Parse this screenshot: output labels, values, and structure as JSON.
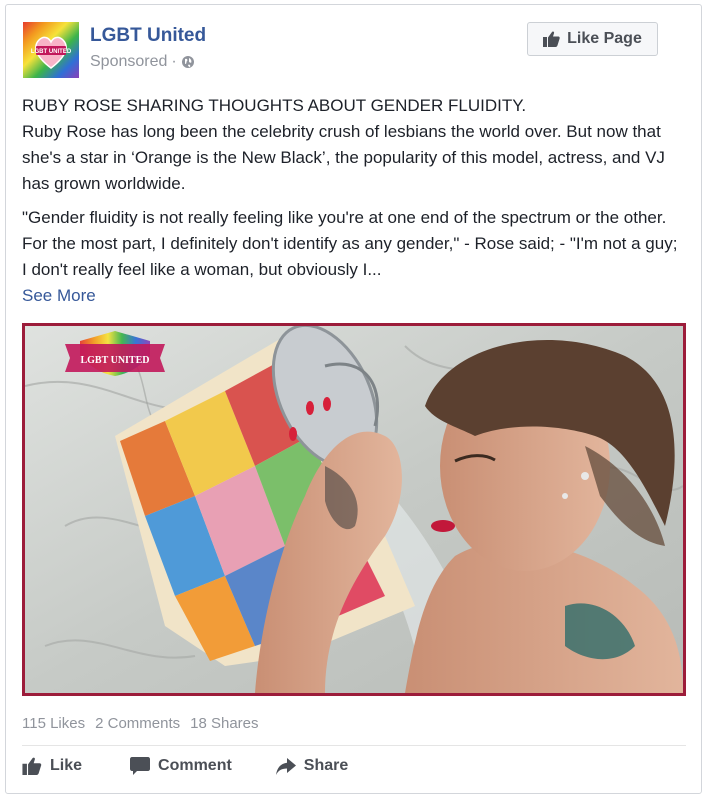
{
  "post": {
    "page_name": "LGBT United",
    "sponsored_label": "Sponsored",
    "separator": "·",
    "like_page_label": "Like Page",
    "headline": "RUBY ROSE SHARING THOUGHTS ABOUT GENDER FLUIDITY.",
    "body": "Ruby Rose has long been the celebrity crush of lesbians the world over. But now that she's a star in ‘Orange is the New Black’, the popularity of this model, actress, and VJ has grown worldwide.",
    "quote": "\"Gender fluidity is not really feeling like you're at one end of the spectrum or the other. For the most part, I definitely don't identify as any gender,\" - Rose said; - \"I'm not a guy; I don't really feel like a woman, but obviously I...",
    "see_more_label": "See More",
    "image_logo_text": "LGBT UNITED",
    "avatar_logo_text": "LGBT UNITED"
  },
  "stats": {
    "likes": "115 Likes",
    "comments": "2 Comments",
    "shares": "18 Shares"
  },
  "actions": {
    "like_label": "Like",
    "comment_label": "Comment",
    "share_label": "Share"
  },
  "colors": {
    "link_blue": "#365899",
    "meta_gray": "#90949c",
    "image_border": "#9c1c3a"
  },
  "icons": {
    "globe": "globe-icon",
    "thumbs_up": "thumbs-up-icon",
    "comment": "comment-icon",
    "share": "share-icon"
  }
}
